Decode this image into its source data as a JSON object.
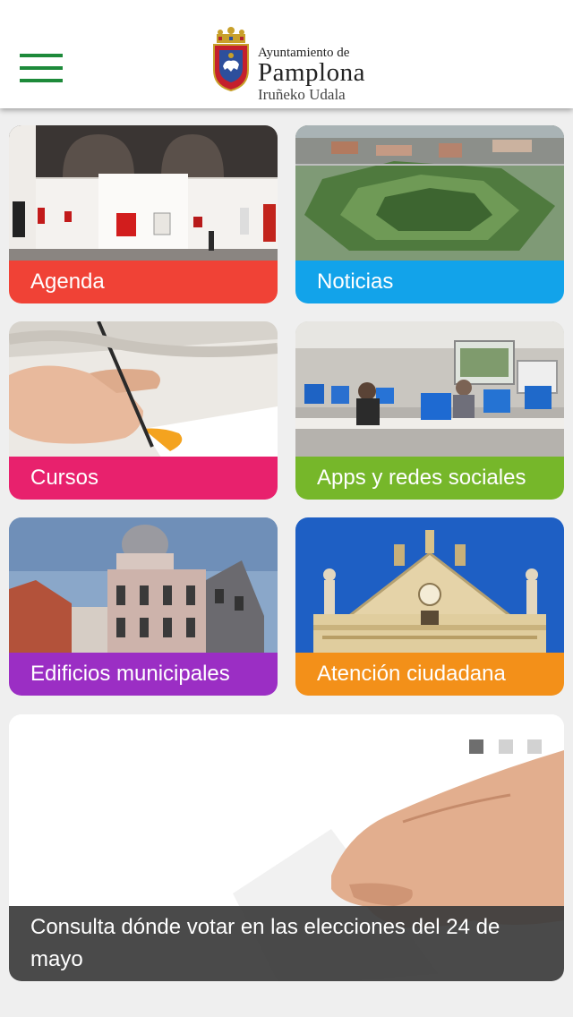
{
  "header": {
    "logo": {
      "line1": "Ayuntamiento de",
      "line2": "Pamplona",
      "line3": "Iruñeko Udala"
    },
    "menu_icon": "hamburger-menu-icon",
    "accent_color": "#1d8a3a"
  },
  "tiles": [
    {
      "label": "Agenda",
      "color": "#f04236"
    },
    {
      "label": "Noticias",
      "color": "#12a3ea"
    },
    {
      "label": "Cursos",
      "color": "#e8216d"
    },
    {
      "label": "Apps y redes sociales",
      "color": "#76b72a"
    },
    {
      "label": "Edificios municipales",
      "color": "#9b2ec4"
    },
    {
      "label": "Atención ciudadana",
      "color": "#f39019"
    }
  ],
  "banner": {
    "caption": "Consulta dónde votar en las elecciones del 24 de mayo",
    "slides_total": 3,
    "active_slide": 1,
    "active_dot_color": "#6e6e6e",
    "inactive_dot_color": "#d2d2d2"
  }
}
